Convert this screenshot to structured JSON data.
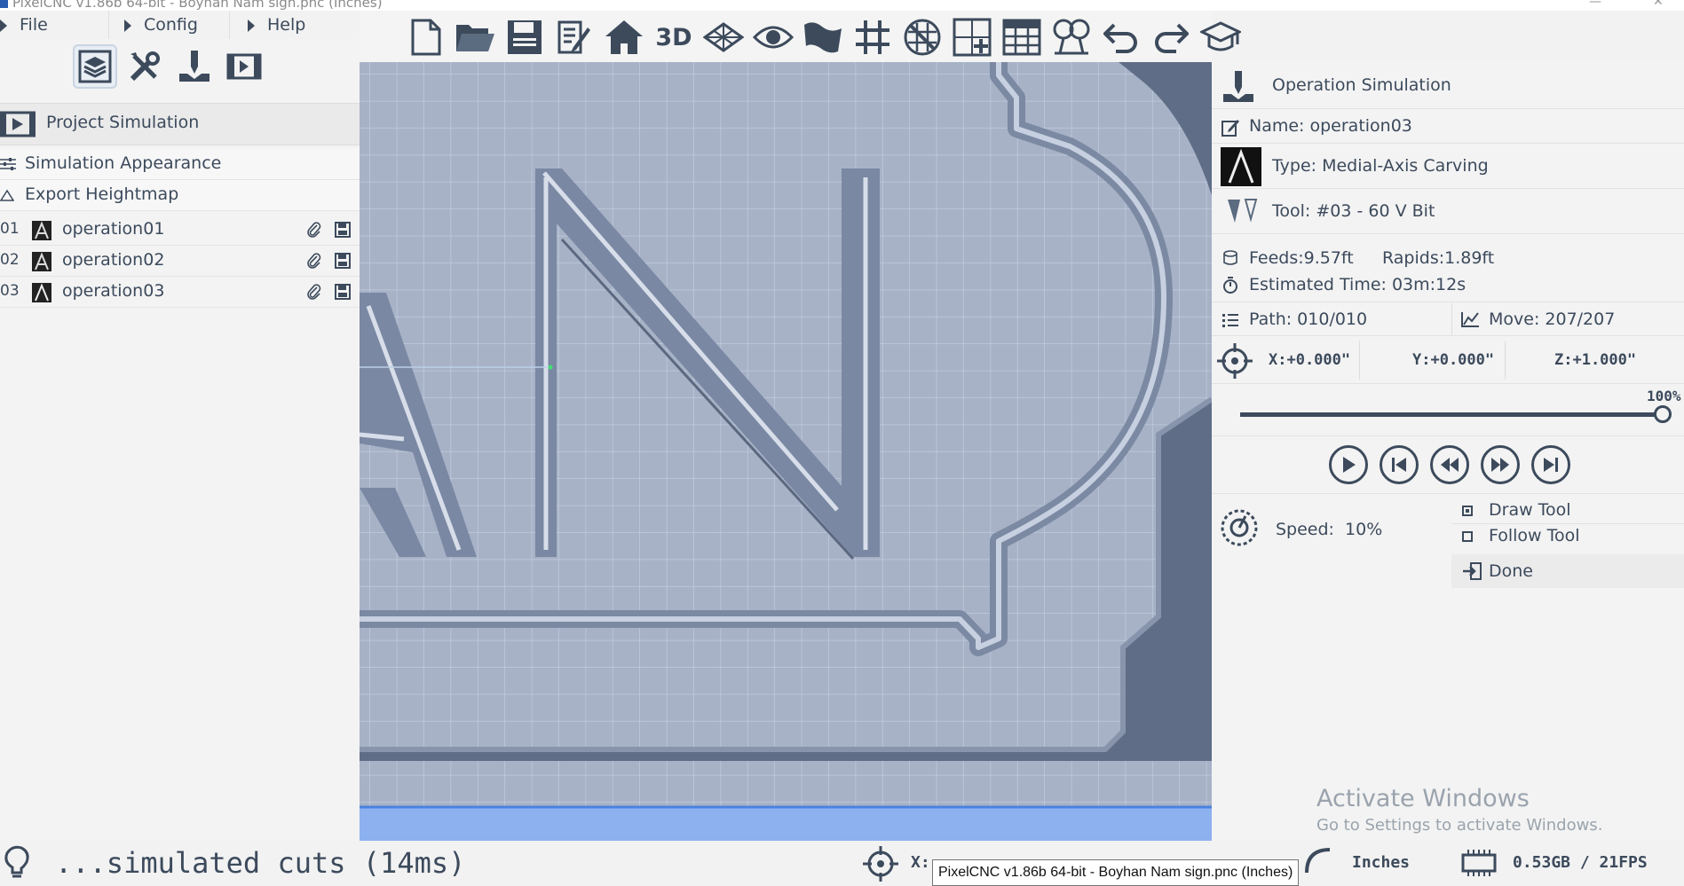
{
  "window": {
    "title": "PixelCNC v1.86b 64-bit  -  Boyhan Nam sign.pnc (Inches)"
  },
  "menu": {
    "items": [
      {
        "label": "File"
      },
      {
        "label": "Config"
      },
      {
        "label": "Help"
      }
    ]
  },
  "left_panel": {
    "mode_icons": [
      "layers-icon",
      "tools-icon",
      "operation-icon",
      "film-icon"
    ],
    "project_simulation": "Project Simulation",
    "simulation_appearance": "Simulation Appearance",
    "export_heightmap": "Export Heightmap",
    "operations": [
      {
        "num": "01",
        "name": "operation01"
      },
      {
        "num": "02",
        "name": "operation02"
      },
      {
        "num": "03",
        "name": "operation03"
      }
    ]
  },
  "toolbar": {
    "icons": [
      "new-file-icon",
      "open-folder-icon",
      "save-icon",
      "edit-icon",
      "home-view-icon",
      "3d-view-icon",
      "grid-plane-icon",
      "eye-icon",
      "flag-icon",
      "grid-icon",
      "no-grid-icon",
      "add-image-icon",
      "table-icon",
      "measure-icon",
      "undo-icon",
      "redo-icon",
      "tutorial-icon"
    ],
    "label_3d": "3D"
  },
  "right_panel": {
    "title": "Operation Simulation",
    "name": "Name: operation03",
    "type": "Type: Medial-Axis Carving",
    "tool": "Tool: #03 - 60 V Bit",
    "feeds": "Feeds:9.57ft",
    "rapids": "Rapids:1.89ft",
    "estimated_time": "Estimated Time: 03m:12s",
    "path": "Path: 010/010",
    "move": "Move: 207/207",
    "x": "X:+0.000\"",
    "y": "Y:+0.000\"",
    "z": "Z:+1.000\"",
    "progress_label": "100%",
    "progress": 1.0,
    "speed": "Speed:  10%",
    "draw_tool": "Draw Tool",
    "draw_tool_checked": true,
    "follow_tool": "Follow Tool",
    "follow_tool_checked": false,
    "done": "Done"
  },
  "status": {
    "message": "...simulated cuts (14ms)",
    "cursor_x": "X:",
    "units": "Inches",
    "memory": "0.53GB / 21FPS"
  },
  "tooltip": "PixelCNC v1.86b 64-bit  - Boyhan Nam sign.pnc (Inches)",
  "watermark": {
    "line1": "Activate Windows",
    "line2": "Go to Settings to activate Windows."
  },
  "colors": {
    "text": "#3c4a5c",
    "viewport_bg": "#a7b2c7",
    "grid": "#c5d0e2",
    "panel_bg": "#f3f3f3",
    "floor_blue": "#8db1ef"
  }
}
